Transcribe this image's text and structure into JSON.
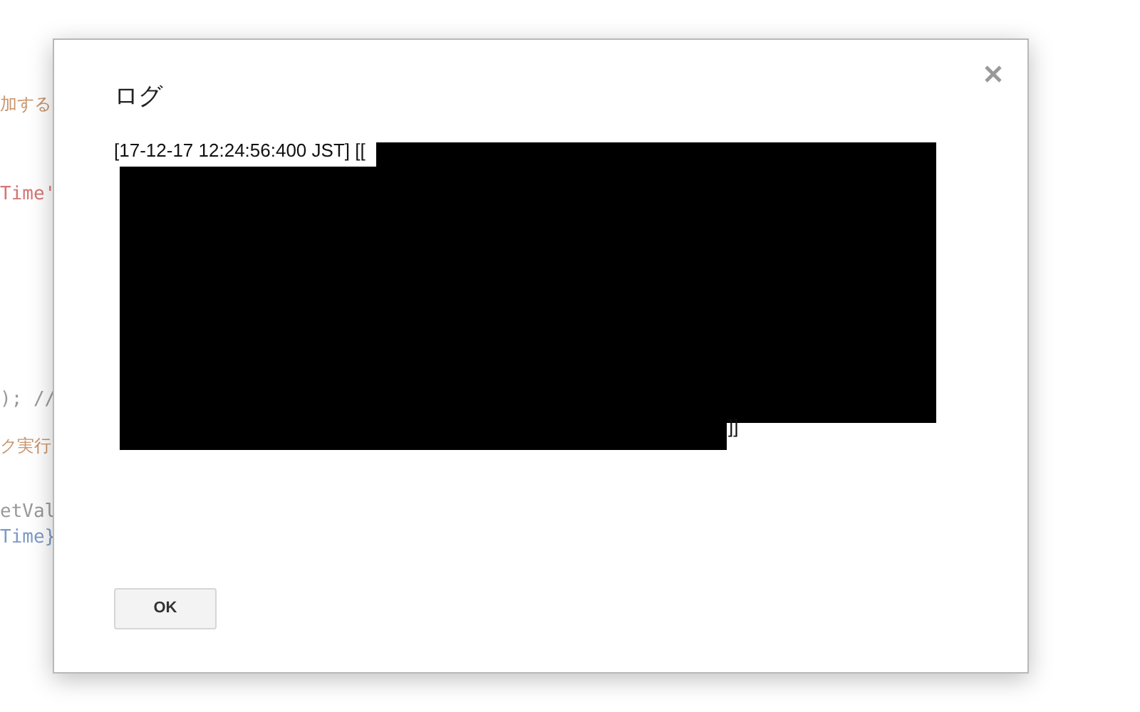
{
  "background_code": [
    {
      "text": "加する",
      "kind": "comment"
    },
    {
      "text": "Time'",
      "kind": "string"
    },
    {
      "text": "); //",
      "kind": "code"
    },
    {
      "text": "ク実行",
      "kind": "comment"
    },
    {
      "text": "etVal",
      "kind": "code"
    },
    {
      "text": "Time}",
      "kind": "variable"
    }
  ],
  "dialog": {
    "title": "ログ",
    "log_start": "[17-12-17 12:24:56:400 JST] [[",
    "log_end": "]]",
    "buttons": [
      "OK"
    ]
  }
}
